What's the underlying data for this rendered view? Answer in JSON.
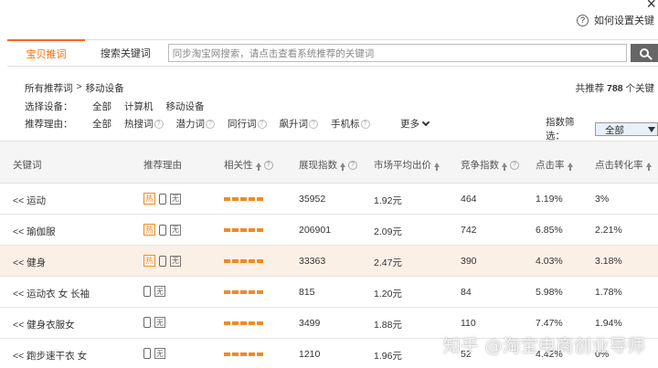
{
  "header": {
    "close_glyph": "×",
    "help_label": "如何设置关键"
  },
  "tabs": {
    "active": "宝贝推词",
    "other": "搜索关键词"
  },
  "search": {
    "placeholder": "同步淘宝网搜索，请点击查看系统推荐的关键词"
  },
  "breadcrumb": {
    "root": "所有推荐词",
    "separator": ">",
    "current": "移动设备"
  },
  "summary": {
    "prefix": "共推荐",
    "count": "788",
    "suffix": "个关键"
  },
  "device_filter": {
    "label": "选择设备：",
    "options": [
      "全部",
      "计算机",
      "移动设备"
    ]
  },
  "reason_filter": {
    "label": "推荐理由：",
    "options": [
      "全部",
      "热搜词",
      "潜力词",
      "同行词",
      "飙升词",
      "手机标"
    ],
    "more_label": "更多"
  },
  "index_filter": {
    "label": "指数筛选：",
    "selected": "全部"
  },
  "table": {
    "columns": [
      "关键词",
      "推荐理由",
      "相关性",
      "展现指数",
      "市场平均出价",
      "竞争指数",
      "点击率",
      "点击转化率"
    ],
    "rows": [
      {
        "keyword": "<< 运动",
        "hot": true,
        "impressions": "35952",
        "avg_bid": "1.92元",
        "competition": "464",
        "ctr": "1.19%",
        "cvr": "3%"
      },
      {
        "keyword": "<< 瑜伽服",
        "hot": true,
        "impressions": "206901",
        "avg_bid": "2.09元",
        "competition": "742",
        "ctr": "6.85%",
        "cvr": "2.21%"
      },
      {
        "keyword": "<< 健身",
        "hot": true,
        "impressions": "33363",
        "avg_bid": "2.47元",
        "competition": "390",
        "ctr": "4.03%",
        "cvr": "3.18%"
      },
      {
        "keyword": "<< 运动衣 女 长袖",
        "hot": false,
        "impressions": "815",
        "avg_bid": "1.20元",
        "competition": "84",
        "ctr": "5.98%",
        "cvr": "1.78%"
      },
      {
        "keyword": "<< 健身衣服女",
        "hot": false,
        "impressions": "3499",
        "avg_bid": "1.88元",
        "competition": "110",
        "ctr": "7.47%",
        "cvr": "1.94%"
      },
      {
        "keyword": "<< 跑步速干衣 女",
        "hot": false,
        "impressions": "1210",
        "avg_bid": "1.96元",
        "competition": "52",
        "ctr": "4.42%",
        "cvr": "0%"
      }
    ],
    "tag_hot_text": "热",
    "tag_box_text": "无"
  },
  "watermark": "知乎 @淘宝电商创业导师",
  "colors": {
    "accent": "#ff6600",
    "bar": "#f08a24",
    "highlight_row": "#fbf0e6"
  }
}
